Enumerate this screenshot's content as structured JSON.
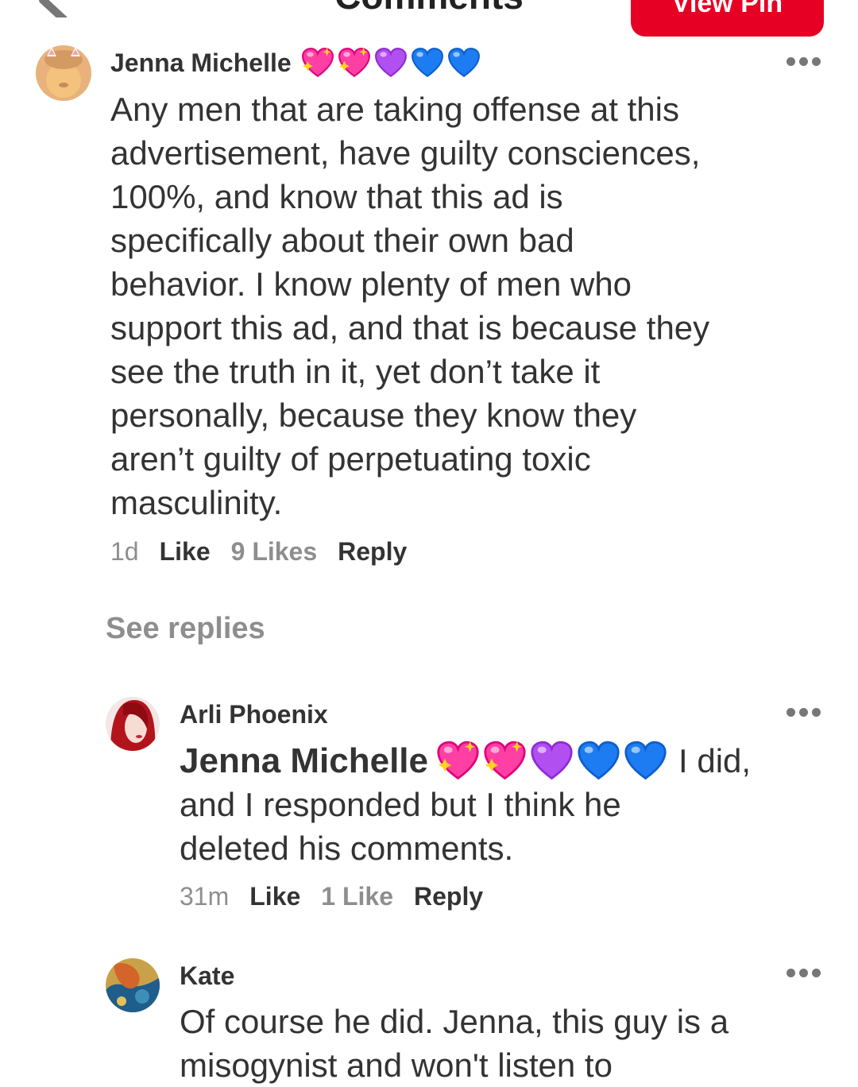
{
  "header": {
    "title": "Comments",
    "view_pin_label": "View Pin"
  },
  "colors": {
    "brand_red": "#e60023",
    "text_dark": "#333333",
    "text_muted": "#8e8e8e"
  },
  "comments": [
    {
      "author": "Jenna Michelle",
      "author_emoji": [
        "sparkling-heart",
        "sparkling-heart",
        "purple-heart",
        "blue-heart",
        "blue-heart"
      ],
      "lines": [
        "Any men that are taking offense at this",
        "advertisement, have guilty consciences,",
        "100%, and know that this ad is",
        "specifically about their own bad",
        "behavior. I know plenty of men who",
        "support this ad, and that is because they",
        "see the truth in it, yet don’t take it",
        "personally, because they know they",
        "aren’t guilty of perpetuating toxic",
        "masculinity."
      ],
      "time": "1d",
      "like_label": "Like",
      "likes_count": "9 Likes",
      "reply_label": "Reply"
    }
  ],
  "see_replies_label": "See replies",
  "replies": [
    {
      "author": "Arli Phoenix",
      "mention": "Jenna Michelle",
      "mention_emoji": [
        "sparkling-heart",
        "sparkling-heart",
        "purple-heart",
        "blue-heart",
        "blue-heart"
      ],
      "first_line_tail": "I did,",
      "lines": [
        "and I responded but I think he",
        "deleted his comments."
      ],
      "time": "31m",
      "like_label": "Like",
      "likes_count": "1 Like",
      "reply_label": "Reply"
    },
    {
      "author": "Kate",
      "lines": [
        "Of course he did. Jenna, this guy is a",
        "misogynist and won't listen to"
      ]
    }
  ]
}
